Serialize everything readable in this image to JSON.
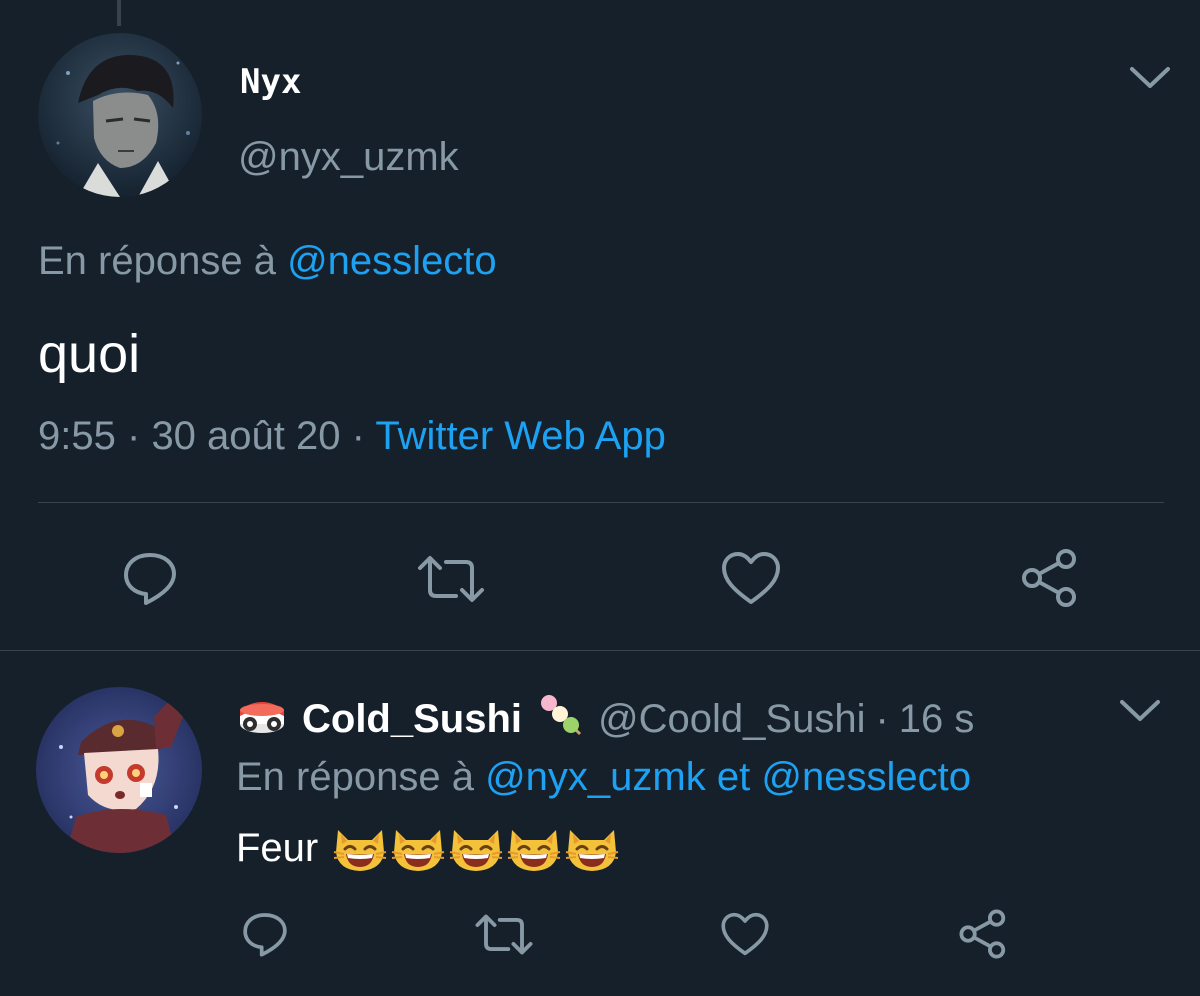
{
  "main_tweet": {
    "author_name": "Nyx",
    "handle": "@nyx_uzmk",
    "reply_prefix": "En réponse à",
    "reply_to": "@nesslecto",
    "text": "quoi",
    "time": "9:55",
    "separator": "·",
    "date": "30 août 20",
    "source": "Twitter Web App"
  },
  "reply_tweet": {
    "name_emoji_left": "sushi-emoji",
    "author_name": "Cold_Sushi",
    "name_emoji_right": "dango-emoji",
    "handle": "@Coold_Sushi",
    "separator": "·",
    "time_ago": "16 s",
    "reply_prefix": "En réponse à",
    "reply_to_1": "@nyx_uzmk",
    "reply_conjunction": "et",
    "reply_to_2": "@nesslecto",
    "text": "Feur",
    "emoji": "grinning-cat-face",
    "emoji_count": 5
  },
  "icons": {
    "actions": [
      "reply-icon",
      "retweet-icon",
      "like-icon",
      "share-icon"
    ],
    "menu": "chevron-down-icon"
  },
  "colors": {
    "background": "#15202b",
    "text": "#ffffff",
    "muted": "#8899a6",
    "link": "#1da1f2",
    "divider": "#38444d"
  }
}
